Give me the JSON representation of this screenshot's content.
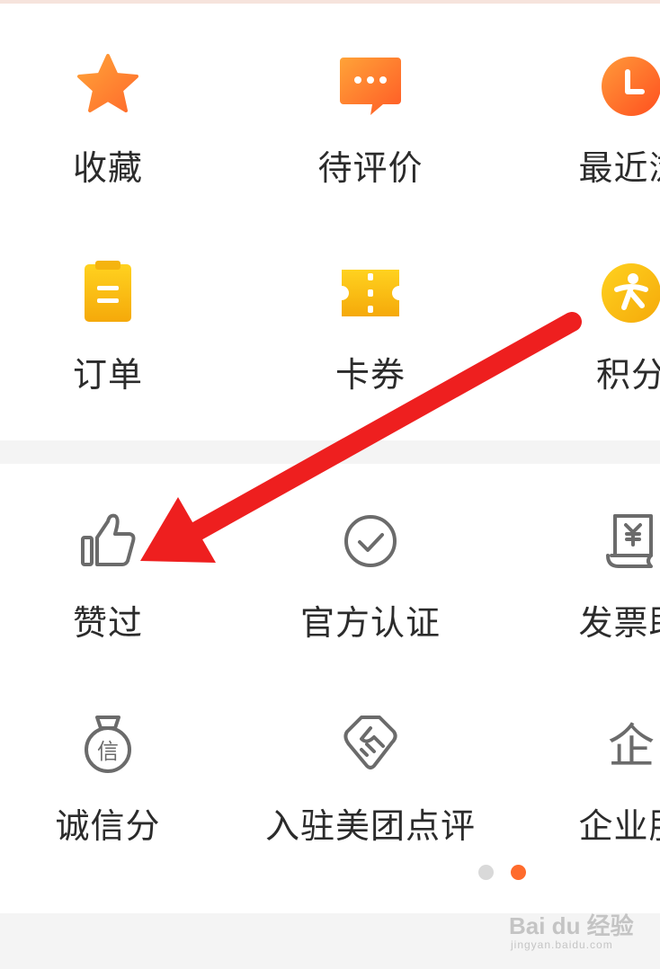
{
  "colors": {
    "accent_orange": "#ff6b2c",
    "icon_yellow": "#f7c21d",
    "icon_gray": "#6b6b6b",
    "arrow_red": "#ee1f1f",
    "dot_inactive": "#d9d9d9",
    "dot_active": "#ff6b2c"
  },
  "section1": {
    "items": [
      {
        "label": "收藏",
        "icon": "star-icon"
      },
      {
        "label": "待评价",
        "icon": "chat-bubble-icon"
      },
      {
        "label": "最近浏",
        "icon": "clock-icon"
      },
      {
        "label": "订单",
        "icon": "clipboard-icon"
      },
      {
        "label": "卡券",
        "icon": "ticket-icon"
      },
      {
        "label": "积分",
        "icon": "points-icon"
      }
    ]
  },
  "section2": {
    "items": [
      {
        "label": "赞过",
        "icon": "thumbs-up-icon"
      },
      {
        "label": "官方认证",
        "icon": "check-circle-icon"
      },
      {
        "label": "发票助",
        "icon": "invoice-icon"
      },
      {
        "label": "诚信分",
        "icon": "credit-badge-icon"
      },
      {
        "label": "入驻美团点评",
        "icon": "handshake-icon"
      },
      {
        "label": "企业服",
        "icon": "enterprise-icon"
      }
    ]
  },
  "pager": {
    "total": 2,
    "active": 2
  },
  "watermark": {
    "main": "Bai du 经验",
    "sub": "jingyan.baidu.com"
  }
}
